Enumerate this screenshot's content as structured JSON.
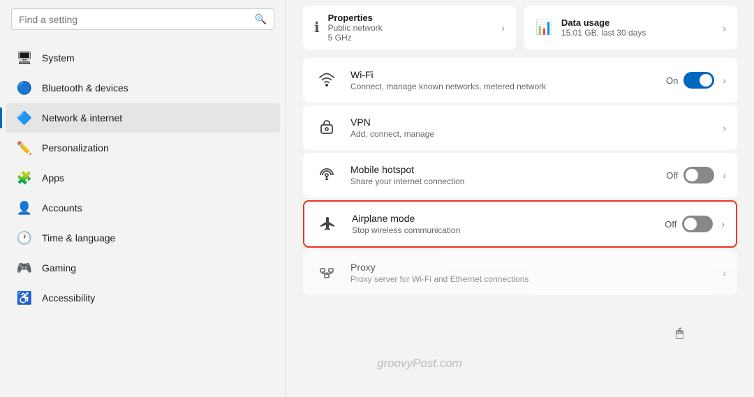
{
  "sidebar": {
    "search": {
      "placeholder": "Find a setting",
      "icon": "🔍"
    },
    "items": [
      {
        "id": "system",
        "label": "System",
        "icon": "🖥",
        "active": false
      },
      {
        "id": "bluetooth",
        "label": "Bluetooth & devices",
        "icon": "🔵",
        "active": false
      },
      {
        "id": "network",
        "label": "Network & internet",
        "icon": "🔷",
        "active": true
      },
      {
        "id": "personalization",
        "label": "Personalization",
        "icon": "✏️",
        "active": false
      },
      {
        "id": "apps",
        "label": "Apps",
        "icon": "🧩",
        "active": false
      },
      {
        "id": "accounts",
        "label": "Accounts",
        "icon": "👤",
        "active": false
      },
      {
        "id": "time",
        "label": "Time & language",
        "icon": "🕐",
        "active": false
      },
      {
        "id": "gaming",
        "label": "Gaming",
        "icon": "🎮",
        "active": false
      },
      {
        "id": "accessibility",
        "label": "Accessibility",
        "icon": "♿",
        "active": false
      }
    ]
  },
  "top_cards": [
    {
      "id": "properties",
      "icon": "ℹ",
      "title": "Properties",
      "subtitle1": "Public network",
      "subtitle2": "5 GHz"
    },
    {
      "id": "data_usage",
      "icon": "📊",
      "title": "Data usage",
      "subtitle1": "15.01 GB, last 30 days"
    }
  ],
  "settings": [
    {
      "id": "wifi",
      "icon": "wifi",
      "title": "Wi-Fi",
      "subtitle": "Connect, manage known networks, metered network",
      "status": "On",
      "toggle": "on",
      "has_chevron": true,
      "highlighted": false
    },
    {
      "id": "vpn",
      "icon": "vpn",
      "title": "VPN",
      "subtitle": "Add, connect, manage",
      "status": "",
      "toggle": null,
      "has_chevron": true,
      "highlighted": false
    },
    {
      "id": "hotspot",
      "icon": "hotspot",
      "title": "Mobile hotspot",
      "subtitle": "Share your internet connection",
      "status": "Off",
      "toggle": "off",
      "has_chevron": true,
      "highlighted": false
    },
    {
      "id": "airplane",
      "icon": "airplane",
      "title": "Airplane mode",
      "subtitle": "Stop wireless communication",
      "status": "Off",
      "toggle": "off",
      "has_chevron": true,
      "highlighted": true
    },
    {
      "id": "proxy",
      "icon": "proxy",
      "title": "Proxy",
      "subtitle": "Proxy server for Wi-Fi and Ethernet connections",
      "status": "",
      "toggle": null,
      "has_chevron": true,
      "highlighted": false,
      "partial": true
    }
  ],
  "watermark": "groovyPost.com"
}
